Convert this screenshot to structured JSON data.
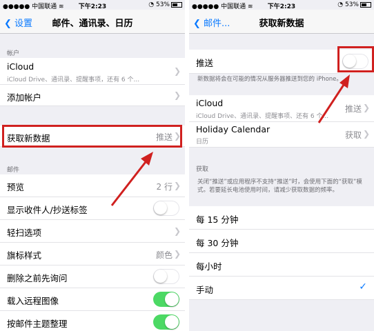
{
  "left": {
    "status": {
      "carrier": "中国联通",
      "time": "下午2:23",
      "battery": "53%"
    },
    "nav": {
      "back": "设置",
      "title": "邮件、通讯录、日历"
    },
    "accounts_header": "帐户",
    "accounts": [
      {
        "label": "iCloud",
        "sub": "iCloud Drive、通讯录、提醒事项，还有 6 个..."
      },
      {
        "label": "添加帐户"
      }
    ],
    "fetch": {
      "label": "获取新数据",
      "value": "推送"
    },
    "mail_header": "邮件",
    "mail": [
      {
        "label": "预览",
        "value": "2 行"
      },
      {
        "label": "显示收件人/抄送标签",
        "toggle": false
      },
      {
        "label": "轻扫选项"
      },
      {
        "label": "旗标样式",
        "value": "颜色"
      },
      {
        "label": "删除之前先询问",
        "toggle": false
      },
      {
        "label": "载入远程图像",
        "toggle": true
      },
      {
        "label": "按邮件主题整理",
        "toggle": true
      }
    ]
  },
  "right": {
    "status": {
      "carrier": "中国联通",
      "time": "下午2:23",
      "battery": "53%"
    },
    "nav": {
      "back": "邮件...",
      "title": "获取新数据"
    },
    "push": {
      "label": "推送",
      "on": false
    },
    "push_note": "新数据将会在可能的情况从服务器推送到您的 iPhone。",
    "accounts": [
      {
        "label": "iCloud",
        "sub": "iCloud Drive、通讯录、提醒事项、还有 6 个...",
        "value": "推送"
      },
      {
        "label": "Holiday Calendar",
        "sub": "日历",
        "value": "获取"
      }
    ],
    "fetch_header": "获取",
    "fetch_note": "关闭“推送”或应用程序不支持“推送”时，会使用下面的“获取”模式。若要延长电池使用时间，请减少获取数据的频率。",
    "options": [
      {
        "label": "每 15 分钟",
        "checked": false
      },
      {
        "label": "每 30 分钟",
        "checked": false
      },
      {
        "label": "每小时",
        "checked": false
      },
      {
        "label": "手动",
        "checked": true
      }
    ]
  },
  "colors": {
    "accent": "#0a7aff",
    "toggle_on": "#4cd964",
    "highlight": "#d0201f"
  },
  "icons": {
    "chevron": "chevron-right-icon",
    "back": "chevron-left-icon",
    "check": "checkmark-icon",
    "wifi": "wifi-icon"
  }
}
